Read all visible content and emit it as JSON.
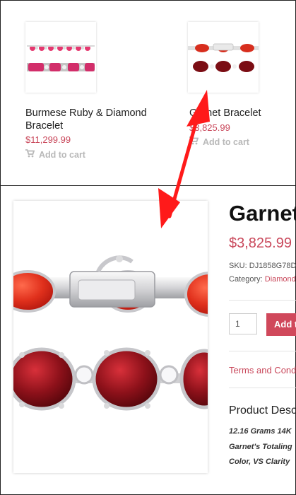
{
  "related_products": [
    {
      "name": "Burmese Ruby & Diamond Bracelet",
      "price": "$11,299.99",
      "add_to_cart": "Add to cart"
    },
    {
      "name": "Garnet Bracelet",
      "price": "$3,825.99",
      "add_to_cart": "Add to cart"
    }
  ],
  "product": {
    "title": "Garnet",
    "price": "$3,825.99",
    "sku_label": "SKU:",
    "sku_value": "DJ1858G78D",
    "category_label": "Category:",
    "category_value": "Diamond",
    "quantity": "1",
    "add_to_cart_label": "Add to",
    "terms_link": "Terms and Cond",
    "description_heading": "Product Desc",
    "description_lines": [
      "12.16 Grams 14K",
      "Garnet's Totaling",
      "Color, VS Clarity"
    ]
  },
  "colors": {
    "accent": "#c9485b",
    "button": "#d0485b",
    "arrow": "#ff1a1a"
  },
  "icons": {
    "cart": "shopping-cart-icon"
  }
}
